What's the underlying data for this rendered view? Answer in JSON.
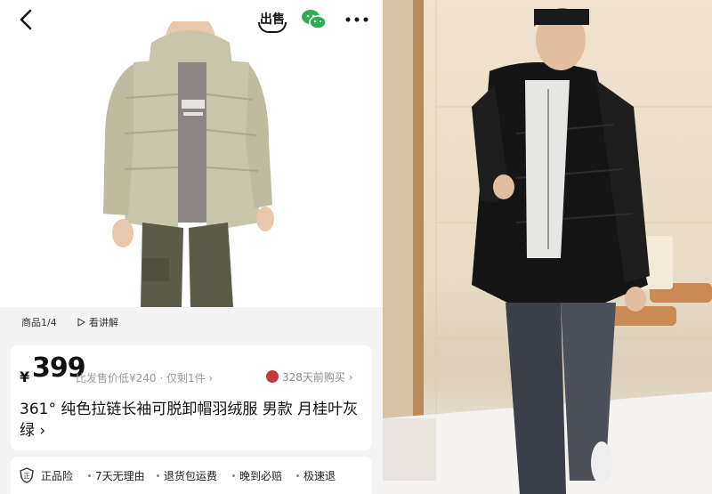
{
  "topbar": {
    "icons": [
      "back-arrow-icon",
      "sell-icon",
      "wechat-icon",
      "more-icon"
    ],
    "sell_label": "出售"
  },
  "gallery": {
    "counter": "商品1/4",
    "explain_label": "看讲解"
  },
  "price": {
    "currency": "¥",
    "value": "399",
    "note": "比发售价低¥240 · 仅剩1件 ›",
    "buyer_note": "328天前购买 ›"
  },
  "product": {
    "title": "361° 纯色拉链长袖可脱卸帽羽绒服 男款 月桂叶灰绿 ›"
  },
  "services": {
    "items": [
      "正品险",
      "7天无理由",
      "退货包运费",
      "晚到必赔",
      "极速退"
    ]
  },
  "colors": {
    "jacket_left": "#c9c5ab",
    "jacket_right": "#151515",
    "pants_left": "#5c5a48",
    "pants_right": "#3b3f4a"
  }
}
